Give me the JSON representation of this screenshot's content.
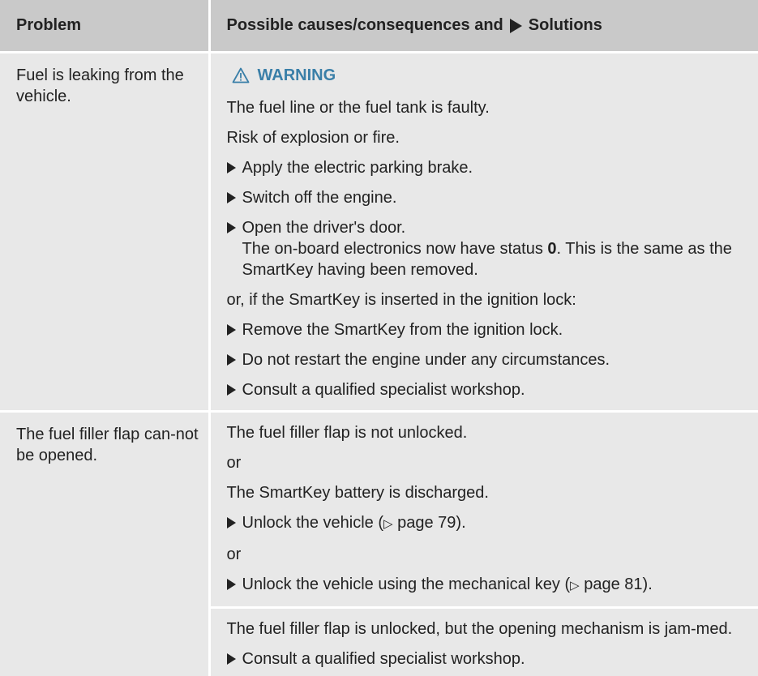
{
  "table": {
    "header": {
      "problem": "Problem",
      "solution_prefix": "Possible causes/consequences and",
      "solution_suffix": "Solutions"
    },
    "row1": {
      "problem": "Fuel is leaking from the vehicle.",
      "warning_label": "WARNING",
      "cause": "The fuel line or the fuel tank is faulty.",
      "risk": "Risk of explosion or fire.",
      "step1": "Apply the electric parking brake.",
      "step2": "Switch off the engine.",
      "step3": "Open the driver's door.",
      "step3_result_a": "The on-board electronics now have status ",
      "step3_result_bold": "0",
      "step3_result_b": ". This is the same as the SmartKey having been removed.",
      "alt_condition": "or, if the SmartKey is inserted in the ignition lock:",
      "step4": "Remove the SmartKey from the ignition lock.",
      "step5": "Do not restart the engine under any circumstances.",
      "step6": "Consult a qualified specialist workshop."
    },
    "row2": {
      "problem": "The fuel filler flap can-not be opened.",
      "cause1": "The fuel filler flap is not unlocked.",
      "or1": "or",
      "cause2": "The SmartKey battery is discharged.",
      "step1_text": "Unlock the vehicle (",
      "step1_ref_symbol": "▷",
      "step1_ref": " page 79).",
      "or2": "or",
      "step2_text": "Unlock the vehicle using the mechanical key (",
      "step2_ref_symbol": "▷",
      "step2_ref": " page 81).",
      "cause3": "The fuel filler flap is unlocked, but the opening mechanism is jam-med.",
      "step3": "Consult a qualified specialist workshop."
    }
  },
  "colors": {
    "header_bg": "#c9c9c9",
    "cell_bg": "#e8e8e8",
    "warning_accent": "#3a7fa8"
  },
  "icons": {
    "warning": "warning-triangle-icon",
    "step_bullet": "triangle-right-icon"
  }
}
